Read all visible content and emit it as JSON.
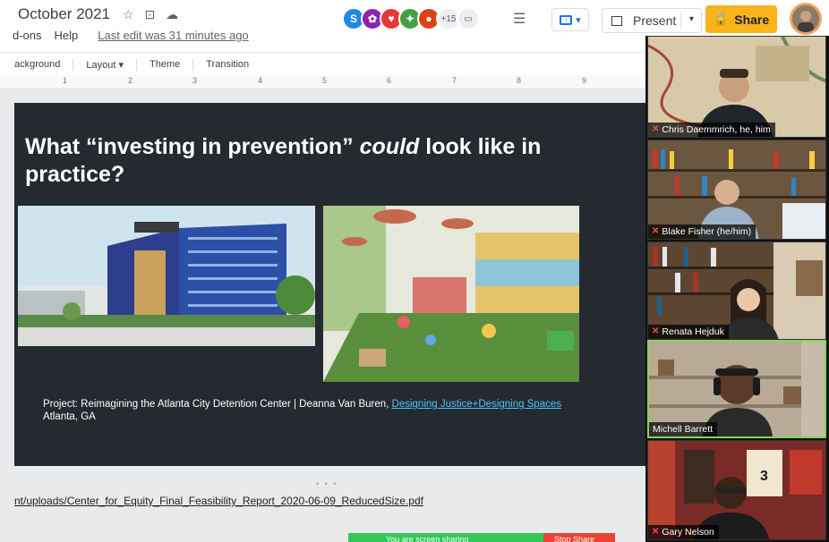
{
  "doc": {
    "title": "October 2021",
    "menu": [
      "d-ons",
      "Help"
    ],
    "last_edit": "Last edit was 31 minutes ago"
  },
  "collaborators": {
    "avatars": [
      {
        "letter": "S",
        "color": "#1e88e5"
      },
      {
        "letter": "✿",
        "color": "#8e24aa"
      },
      {
        "letter": "♥",
        "color": "#e53935"
      },
      {
        "letter": "✦",
        "color": "#43a047"
      },
      {
        "letter": "●",
        "color": "#d84315"
      }
    ],
    "more_count": "+15"
  },
  "header_actions": {
    "present_label": "Present",
    "share_label": "Share"
  },
  "toolbar": {
    "items": [
      "ackground",
      "Layout ▾",
      "Theme",
      "Transition"
    ]
  },
  "ruler": {
    "numbers": [
      "1",
      "2",
      "3",
      "4",
      "5",
      "6",
      "7",
      "8",
      "9"
    ]
  },
  "slide": {
    "title_part1": "What “investing in prevention” ",
    "title_emphasis": "could",
    "title_part2": "  look like in practice?",
    "caption_line1": "Project: Reimagining the Atlanta City Detention Center | Deanna Van Buren, ",
    "caption_link": "Designing Justice+Designing Spaces",
    "caption_line2": "Atlanta, GA"
  },
  "filmstrip_handle": "• • •",
  "url_text": "nt/uploads/Center_for_Equity_Final_Feasibility_Report_2020-06-09_ReducedSize.pdf",
  "screen_share": {
    "status": "You are screen sharing",
    "stop_label": "Stop Share"
  },
  "participants": [
    {
      "name": "Chris Daemmrich, he, him",
      "muted": true,
      "bg": "#c8b89a",
      "active": false
    },
    {
      "name": "Blake Fisher (he/him)",
      "muted": true,
      "bg": "#8a7560",
      "active": false
    },
    {
      "name": "Renata Hejduk",
      "muted": true,
      "bg": "#7a6048",
      "active": false
    },
    {
      "name": "Michell Barrett",
      "muted": false,
      "bg": "#b2a493",
      "active": true
    },
    {
      "name": "Gary Nelson",
      "muted": true,
      "bg": "#7c2a26",
      "active": false
    }
  ]
}
